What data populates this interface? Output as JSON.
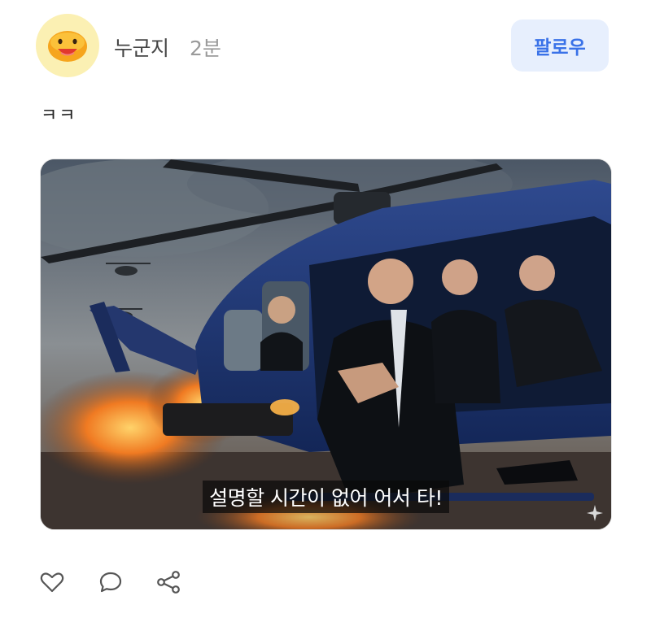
{
  "header": {
    "author_name": "누군지",
    "time_ago": "2분",
    "follow_label": "팔로우",
    "avatar_icon": "smiley-face-icon"
  },
  "post": {
    "text": "ㅋㅋ",
    "media": {
      "caption": "설명할 시간이 없어 어서 타!"
    }
  },
  "actions": {
    "icons": [
      "heart-icon",
      "comment-icon",
      "share-icon"
    ]
  },
  "colors": {
    "follow_bg": "#e7effd",
    "follow_text": "#3a72e8",
    "avatar_bg": "#fbf0b3"
  }
}
